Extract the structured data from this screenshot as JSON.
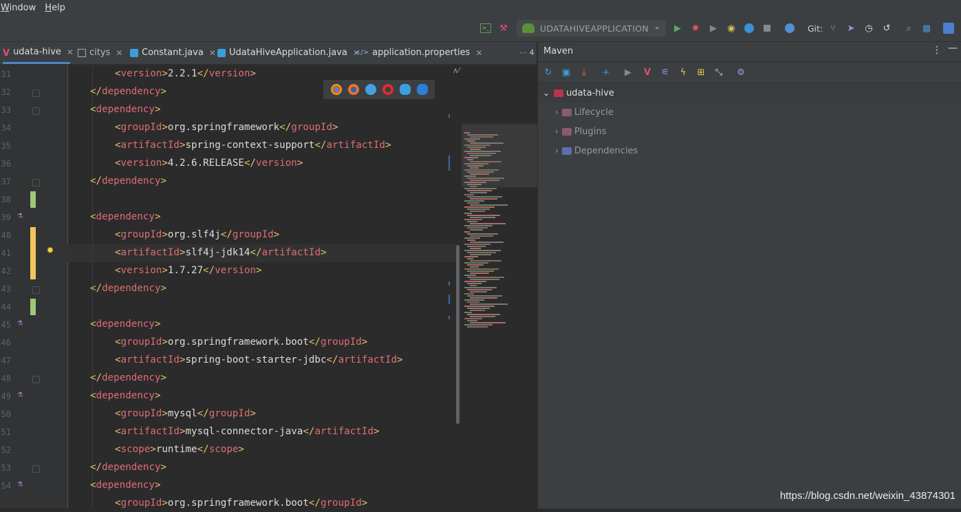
{
  "menu": {
    "window": "Window",
    "help": "Help"
  },
  "run_config": {
    "label": "UDATAHIVEAPPLICATION"
  },
  "git_label": "Git:",
  "tabs": [
    {
      "label": "udata-hive"
    },
    {
      "label": "citys"
    },
    {
      "label": "Constant.java"
    },
    {
      "label": "UdataHiveApplication.java"
    },
    {
      "label": "application.properties"
    }
  ],
  "tab_overflow": "4",
  "line_numbers": [
    "31",
    "32",
    "33",
    "34",
    "35",
    "36",
    "37",
    "38",
    "39",
    "40",
    "41",
    "42",
    "43",
    "44",
    "45",
    "46",
    "47",
    "48",
    "49",
    "50",
    "51",
    "52",
    "53",
    "54"
  ],
  "code": {
    "l31": {
      "open": "version",
      "text": "2.2.1",
      "close": "version"
    },
    "l33": "dependency",
    "l34": {
      "open": "groupId",
      "text": "org.springframework",
      "close": "groupId"
    },
    "l35": {
      "open": "artifactId",
      "text": "spring-context-support",
      "close": "artifactId"
    },
    "l36": {
      "open": "version",
      "text": "4.2.6.RELEASE",
      "close": "version"
    },
    "l39": "dependency",
    "l40": {
      "open": "groupId",
      "text": "org.slf4j",
      "close": "groupId"
    },
    "l41": {
      "open": "artifactId",
      "text": "slf4j-jdk14",
      "close": "artifactId"
    },
    "l42": {
      "open": "version",
      "text": "1.7.27",
      "close": "version"
    },
    "l45": "dependency",
    "l46": {
      "open": "groupId",
      "text": "org.springframework.boot",
      "close": "groupId"
    },
    "l47": {
      "open": "artifactId",
      "text": "spring-boot-starter-jdbc",
      "close": "artifactId"
    },
    "l49": "dependency",
    "l50": {
      "open": "groupId",
      "text": "mysql",
      "close": "groupId"
    },
    "l51": {
      "open": "artifactId",
      "text": "mysql-connector-java",
      "close": "artifactId"
    },
    "l52": {
      "open": "scope",
      "text": "runtime",
      "close": "scope"
    },
    "l54": "dependency",
    "l55": {
      "open": "groupId",
      "text": "org.springframework.boot",
      "close": "groupId"
    }
  },
  "maven": {
    "title": "Maven",
    "root": "udata-hive",
    "children": [
      "Lifecycle",
      "Plugins",
      "Dependencies"
    ]
  },
  "watermark": "https://blog.csdn.net/weixin_43874301"
}
